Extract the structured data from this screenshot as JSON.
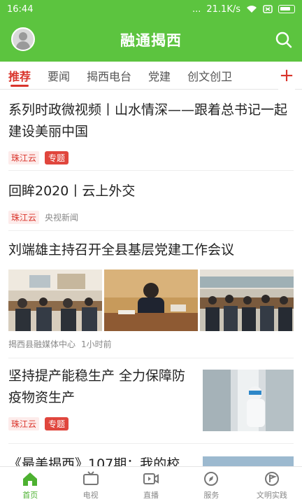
{
  "status": {
    "time": "16:44",
    "dots": "...",
    "speed": "21.1K/s"
  },
  "header": {
    "title": "融通揭西",
    "avatar": "avatar-icon",
    "search": "search-icon"
  },
  "tabs": [
    {
      "label": "推荐",
      "active": true
    },
    {
      "label": "要闻"
    },
    {
      "label": "揭西电台"
    },
    {
      "label": "党建"
    },
    {
      "label": "创文创卫"
    }
  ],
  "tab_add": "+",
  "feed": [
    {
      "headline": "系列时政微视频丨山水情深——跟着总书记一起建设美丽中国",
      "source": "珠江云",
      "badge": "专题"
    },
    {
      "headline": "回眸2020丨云上外交",
      "source": "珠江云",
      "publisher": "央视新闻"
    },
    {
      "headline": "刘端雄主持召开全县基层党建工作会议",
      "publisher": "揭西县融媒体中心",
      "time": "1小时前"
    },
    {
      "headline": "坚持提产能稳生产 全力保障防疫物资生产",
      "source": "珠江云",
      "badge": "专题"
    },
    {
      "headline": "《最美揭西》107期：我的校"
    }
  ],
  "nav": [
    {
      "label": "首页",
      "icon": "home-icon",
      "active": true
    },
    {
      "label": "电视",
      "icon": "tv-icon"
    },
    {
      "label": "直播",
      "icon": "live-icon"
    },
    {
      "label": "服务",
      "icon": "compass-icon"
    },
    {
      "label": "文明实践",
      "icon": "flag-icon"
    }
  ],
  "colors": {
    "brand": "#5cc43f",
    "accent": "#d9342b"
  }
}
